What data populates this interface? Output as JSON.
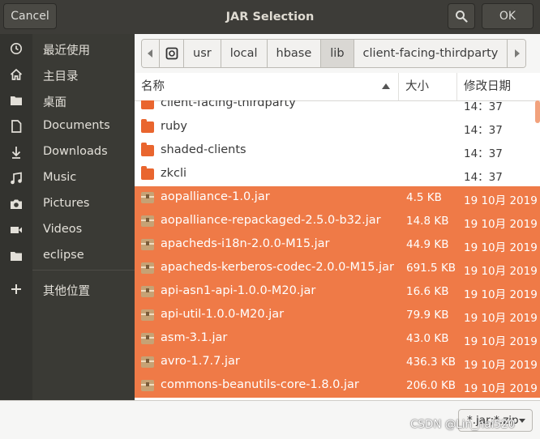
{
  "header": {
    "title": "JAR Selection",
    "cancel_label": "Cancel",
    "ok_label": "OK",
    "search_icon": "search-icon"
  },
  "sidebar": {
    "items": [
      {
        "label": "最近使用",
        "icon": "recent-clock-icon"
      },
      {
        "label": "主目录",
        "icon": "home-icon"
      },
      {
        "label": "桌面",
        "icon": "desktop-folder-icon"
      },
      {
        "label": "Documents",
        "icon": "document-icon"
      },
      {
        "label": "Downloads",
        "icon": "download-arrow-icon"
      },
      {
        "label": "Music",
        "icon": "music-note-icon"
      },
      {
        "label": "Pictures",
        "icon": "camera-icon"
      },
      {
        "label": "Videos",
        "icon": "video-camera-icon"
      },
      {
        "label": "eclipse",
        "icon": "folder-icon"
      },
      {
        "label": "其他位置",
        "icon": "plus-icon"
      }
    ]
  },
  "pathbar": {
    "crumbs": [
      "usr",
      "local",
      "hbase",
      "lib",
      "client-facing-thirdparty"
    ],
    "active_crumb": "lib"
  },
  "columns": {
    "name": "名称",
    "size": "大小",
    "modified": "修改日期"
  },
  "files": [
    {
      "name": "client-facing-thirdparty",
      "size": "",
      "date": "14：37",
      "type": "folder",
      "selected": false
    },
    {
      "name": "ruby",
      "size": "",
      "date": "14：37",
      "type": "folder",
      "selected": false
    },
    {
      "name": "shaded-clients",
      "size": "",
      "date": "14：37",
      "type": "folder",
      "selected": false
    },
    {
      "name": "zkcli",
      "size": "",
      "date": "14：37",
      "type": "folder",
      "selected": false
    },
    {
      "name": "aopalliance-1.0.jar",
      "size": "4.5 KB",
      "date": "19 10月 2019",
      "type": "jar",
      "selected": true
    },
    {
      "name": "aopalliance-repackaged-2.5.0-b32.jar",
      "size": "14.8 KB",
      "date": "19 10月 2019",
      "type": "jar",
      "selected": true
    },
    {
      "name": "apacheds-i18n-2.0.0-M15.jar",
      "size": "44.9 KB",
      "date": "19 10月 2019",
      "type": "jar",
      "selected": true
    },
    {
      "name": "apacheds-kerberos-codec-2.0.0-M15.jar",
      "size": "691.5 KB",
      "date": "19 10月 2019",
      "type": "jar",
      "selected": true
    },
    {
      "name": "api-asn1-api-1.0.0-M20.jar",
      "size": "16.6 KB",
      "date": "19 10月 2019",
      "type": "jar",
      "selected": true
    },
    {
      "name": "api-util-1.0.0-M20.jar",
      "size": "79.9 KB",
      "date": "19 10月 2019",
      "type": "jar",
      "selected": true
    },
    {
      "name": "asm-3.1.jar",
      "size": "43.0 KB",
      "date": "19 10月 2019",
      "type": "jar",
      "selected": true
    },
    {
      "name": "avro-1.7.7.jar",
      "size": "436.3 KB",
      "date": "19 10月 2019",
      "type": "jar",
      "selected": true
    },
    {
      "name": "commons-beanutils-core-1.8.0.jar",
      "size": "206.0 KB",
      "date": "19 10月 2019",
      "type": "jar",
      "selected": true
    }
  ],
  "filter": {
    "label": "*.jar;*.zip"
  },
  "watermark": "CSDN @Lin_hai520",
  "colors": {
    "selection": "#ef7a47",
    "folder": "#e9652e",
    "headerbar": "#3d3c38",
    "sidebar": "#3a3a35"
  }
}
